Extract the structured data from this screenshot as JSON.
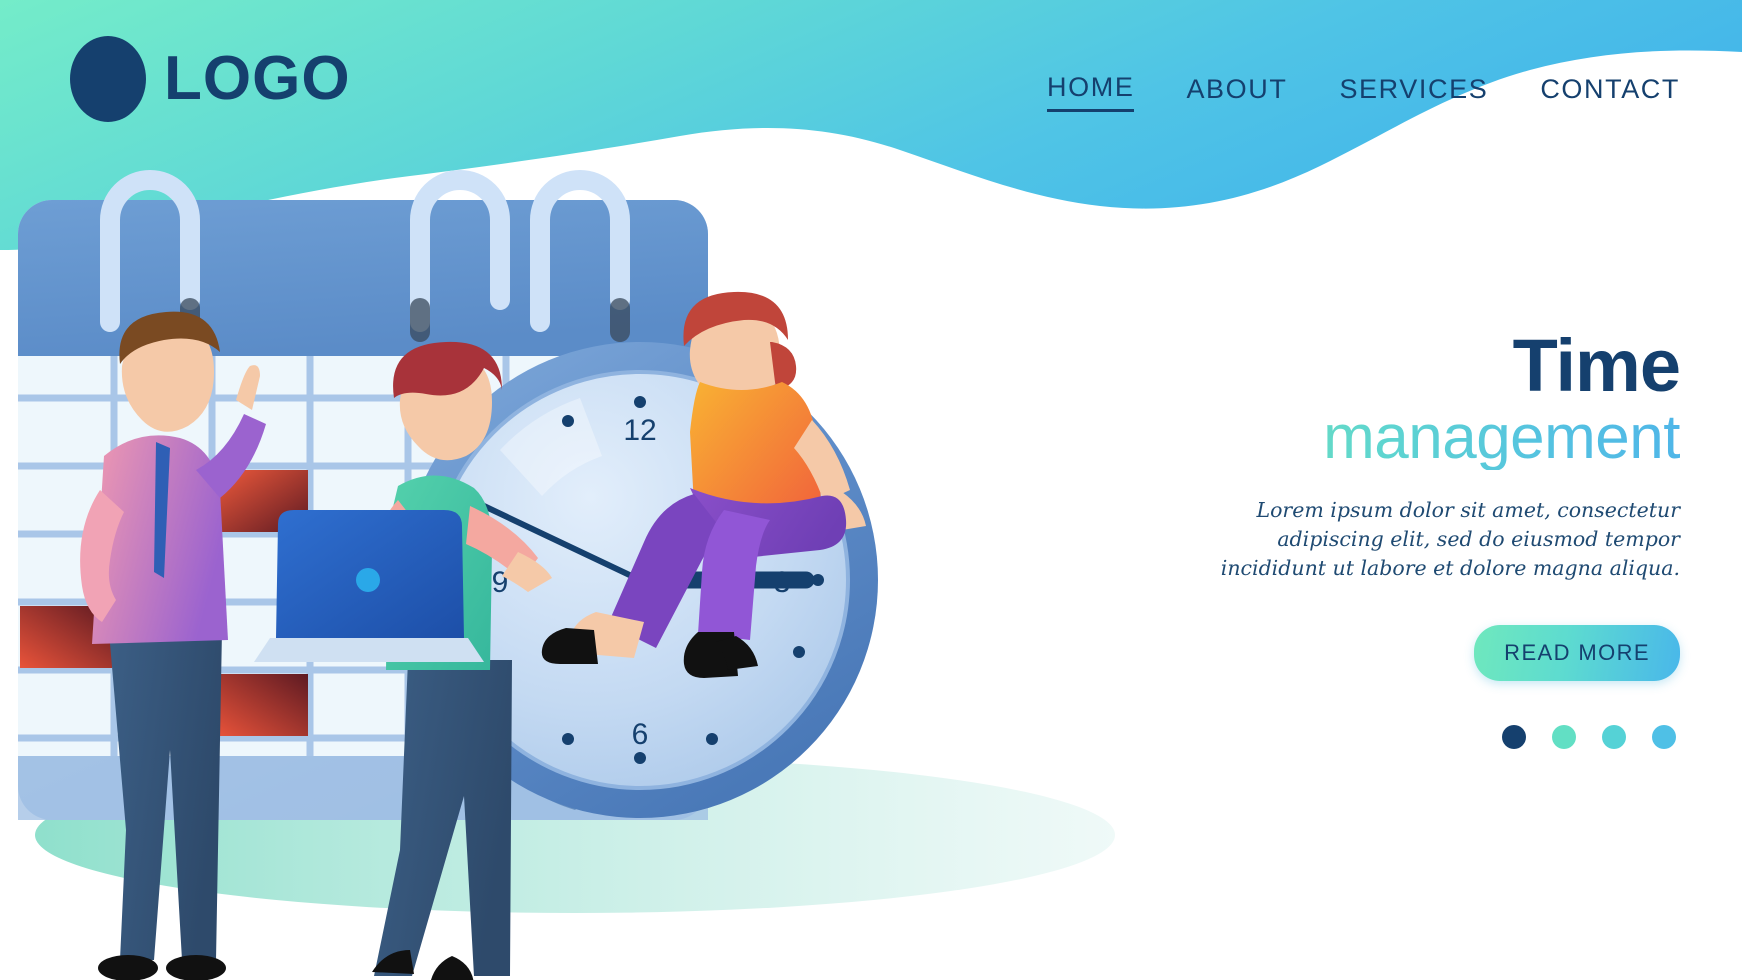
{
  "brand": {
    "logo_icon": "circle-logo-mark",
    "name": "LOGO"
  },
  "nav": {
    "items": [
      {
        "label": "HOME",
        "active": true
      },
      {
        "label": "ABOUT",
        "active": false
      },
      {
        "label": "SERVICES",
        "active": false
      },
      {
        "label": "CONTACT",
        "active": false
      }
    ]
  },
  "hero": {
    "title": "Time",
    "subtitle": "management",
    "body": "Lorem ipsum dolor sit amet, consectetur adipiscing elit, sed do eiusmod tempor incididunt ut labore et dolore magna aliqua.",
    "cta_label": "READ MORE",
    "carousel": {
      "count": 4,
      "active_index": 0,
      "dot_colors": [
        "#15406e",
        "#62dfc4",
        "#55d2d6",
        "#4fc0e6"
      ]
    }
  },
  "illustration": {
    "name": "time-management-scene",
    "clock": {
      "numerals": [
        "12",
        "3",
        "6",
        "9"
      ],
      "hour_hand_label": "hour-hand",
      "minute_hand_label": "minute-hand"
    },
    "calendar": {
      "name": "spiral-calendar",
      "ring_count": 3
    },
    "characters": [
      {
        "name": "man-pointing-up"
      },
      {
        "name": "woman-with-laptop"
      },
      {
        "name": "woman-sitting-on-clock"
      }
    ]
  },
  "colors": {
    "header_gradient_start": "#6fe9c8",
    "header_gradient_end": "#46b8ea",
    "navy": "#15406e",
    "mint": "#6fe8bd",
    "sky": "#49b7ea",
    "ground_shadow": "#7fd3c0"
  }
}
